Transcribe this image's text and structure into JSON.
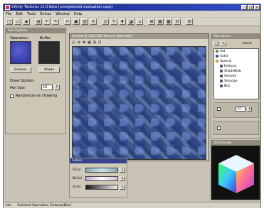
{
  "window": {
    "title": "Infinity Textures v1.0 beta (unregistered evaluation copy)",
    "buttons": [
      "_",
      "□",
      "×"
    ]
  },
  "menu": [
    "File",
    "Edit",
    "Tools",
    "Extras",
    "Window",
    "Help"
  ],
  "toolbar_icons": [
    "new-icon",
    "open-icon",
    "save-icon",
    "print-icon",
    "undo-icon",
    "redo-icon",
    "cut-icon",
    "copy-icon",
    "paste-icon",
    "delete-icon",
    "zoom-icon",
    "pencil-icon",
    "brush-icon",
    "fill-icon",
    "picker-icon",
    "grid-icon",
    "tile-icon",
    "render-icon",
    "export-icon",
    "settings-icon",
    "help-icon"
  ],
  "left_panel": {
    "title": "Tool Options",
    "operation_label": "Operation",
    "buffer_label": "Buffer",
    "emboss_button": "Emboss",
    "shade_button": "Shade",
    "draw_options_label": "Draw Options",
    "pen_size_label": "Pen Size",
    "pen_size_value": "10",
    "checkbox_label": "Randomize on Drawing"
  },
  "canvas": {
    "title": "[Untitled] 128x128 Texture (400x400)"
  },
  "colors_panel": {
    "title": "Colors",
    "rows": [
      {
        "label": "FrCol",
        "value": "1"
      },
      {
        "label": "BkCol",
        "value": "1"
      },
      {
        "label": "Grad",
        "value": "1"
      }
    ]
  },
  "right_panel": {
    "title": "Operations",
    "blend_label": "blend",
    "tree": [
      {
        "label": "Set",
        "color": "#6b8c4a"
      },
      {
        "label": "Solid",
        "color": "#3a5a9a"
      },
      {
        "label": "Special",
        "color": "#c7a33a"
      },
      {
        "label": "Emboss",
        "color": "#556"
      },
      {
        "label": "ShadeBlob",
        "color": "#556"
      },
      {
        "label": "Smooth",
        "color": "#556"
      },
      {
        "label": "Smudge",
        "color": "#556"
      },
      {
        "label": "Blur",
        "color": "#556"
      }
    ],
    "field_value": "32"
  },
  "preview": {
    "title": "3D Preview"
  },
  "status": {
    "left": "Idle",
    "middle": "Selected Operation: Emboss(Blur)"
  }
}
